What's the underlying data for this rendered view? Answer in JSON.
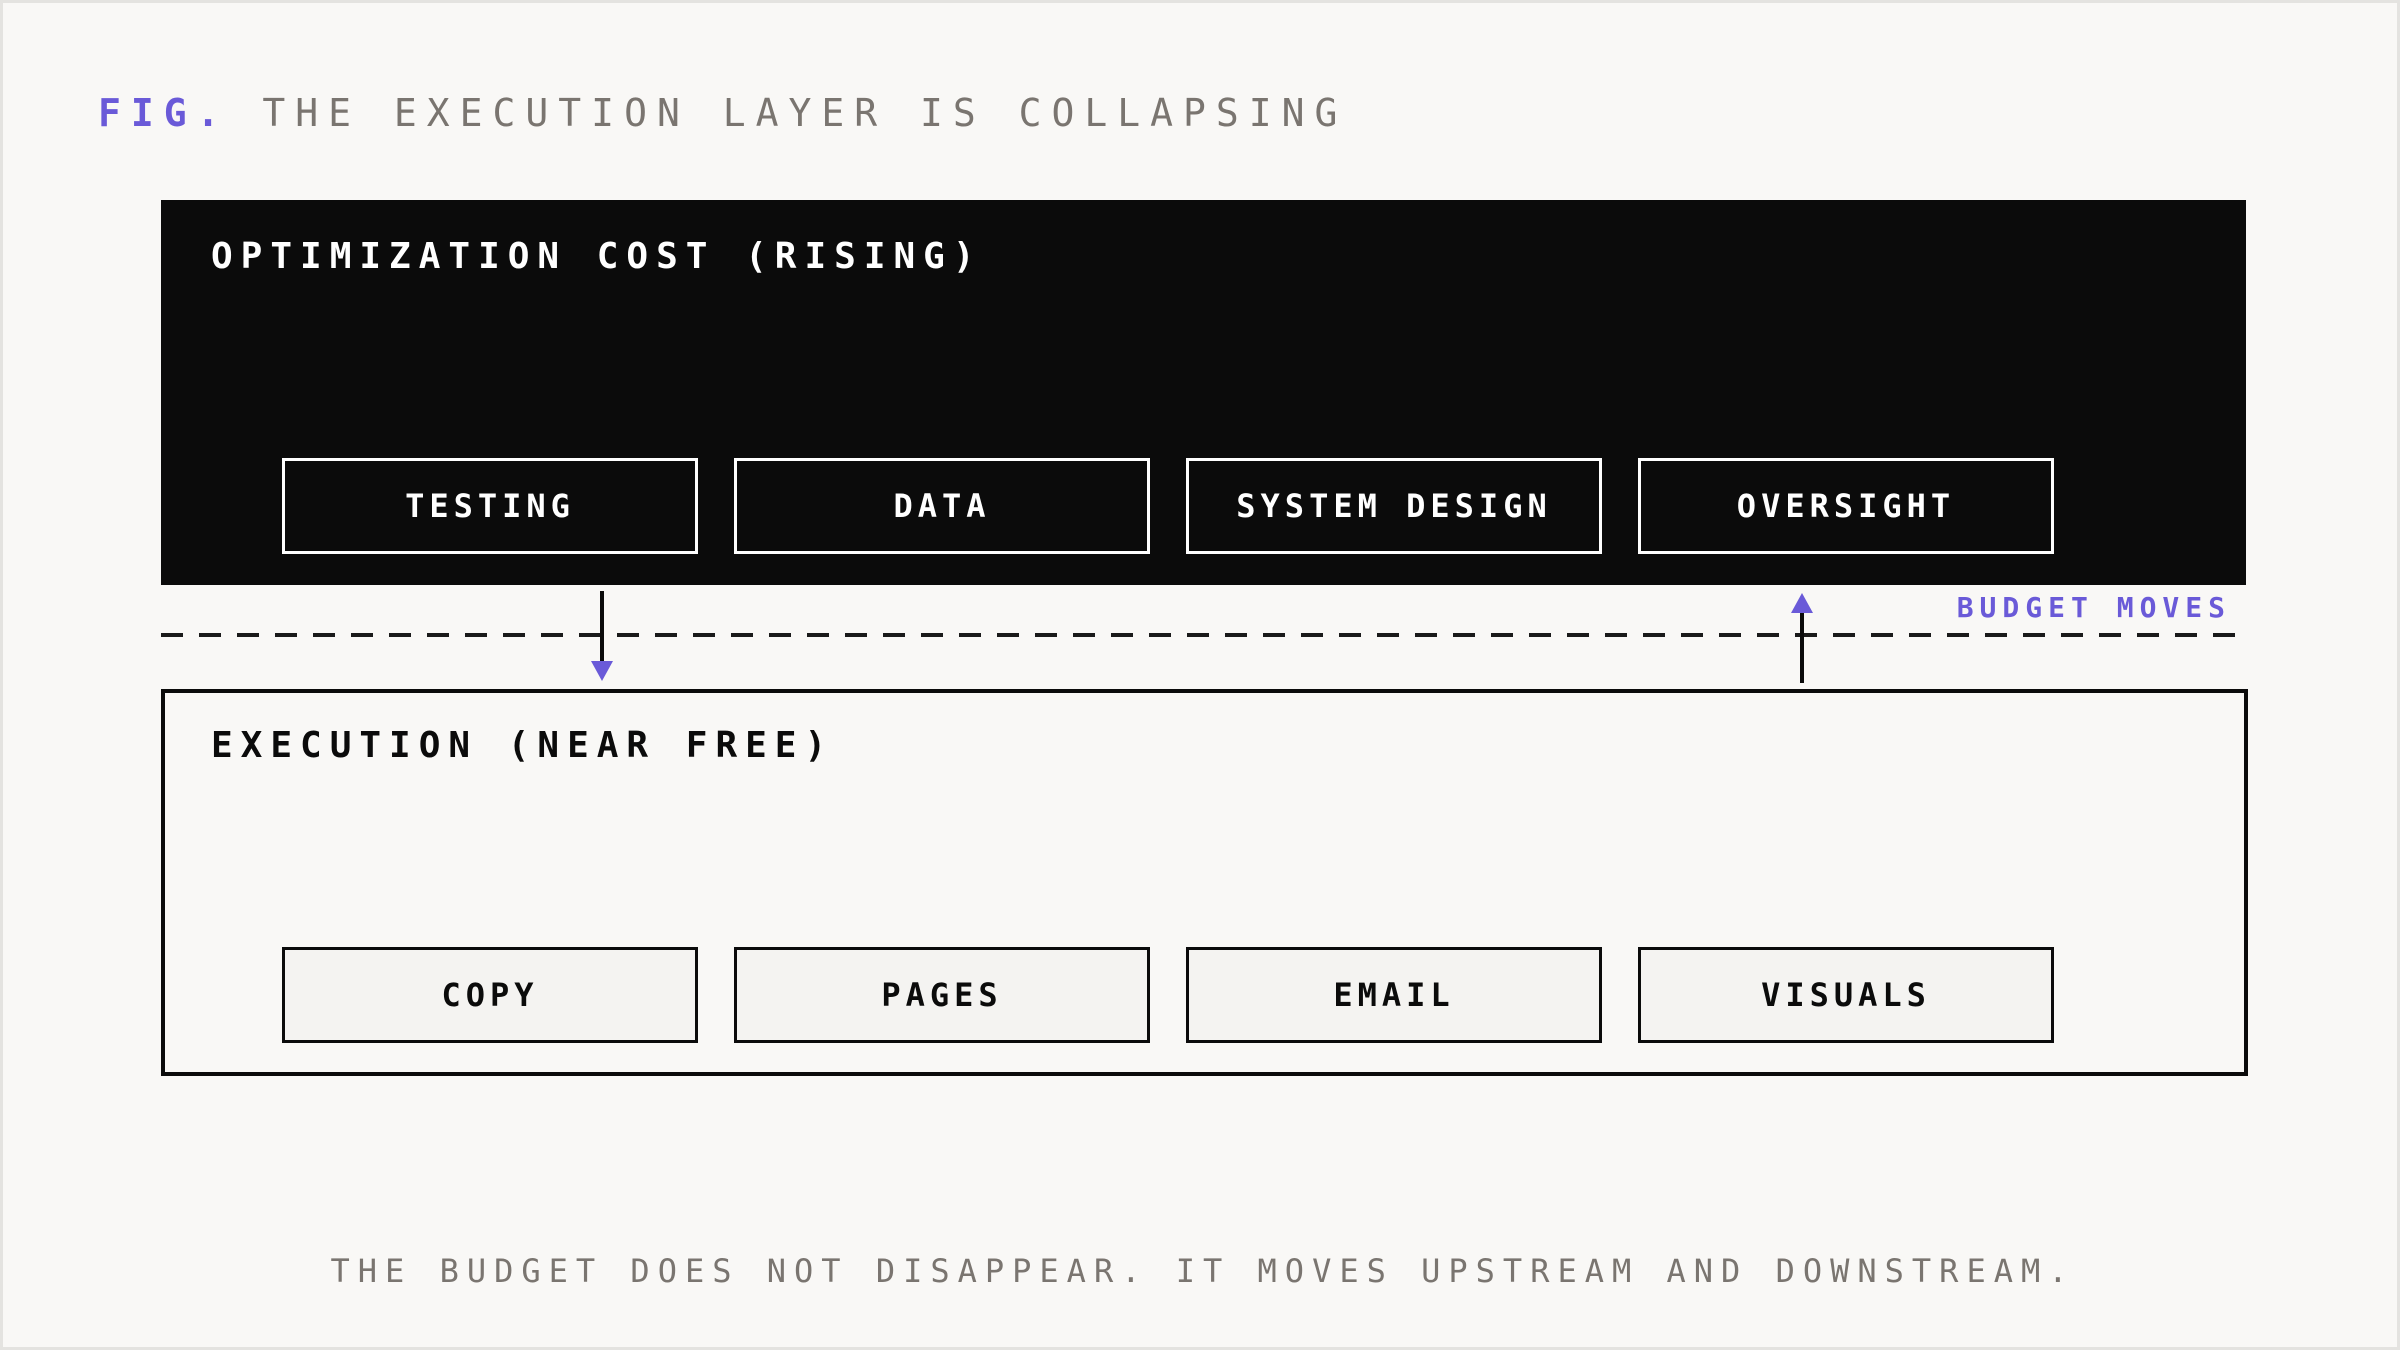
{
  "figure": {
    "prefix": "FIG.",
    "title": "THE EXECUTION LAYER IS COLLAPSING"
  },
  "optimization_layer": {
    "heading": "OPTIMIZATION COST (RISING)",
    "items": [
      "TESTING",
      "DATA",
      "SYSTEM DESIGN",
      "OVERSIGHT"
    ]
  },
  "execution_layer": {
    "heading": "EXECUTION (NEAR FREE)",
    "items": [
      "COPY",
      "PAGES",
      "EMAIL",
      "VISUALS"
    ]
  },
  "budget_label": "BUDGET MOVES",
  "footer": "THE BUDGET DOES NOT DISAPPEAR. IT MOVES UPSTREAM AND DOWNSTREAM.",
  "colors": {
    "accent": "#6a5ad8",
    "dark": "#0b0b0b",
    "background": "#f9f8f6",
    "muted_text": "#7a7570"
  }
}
